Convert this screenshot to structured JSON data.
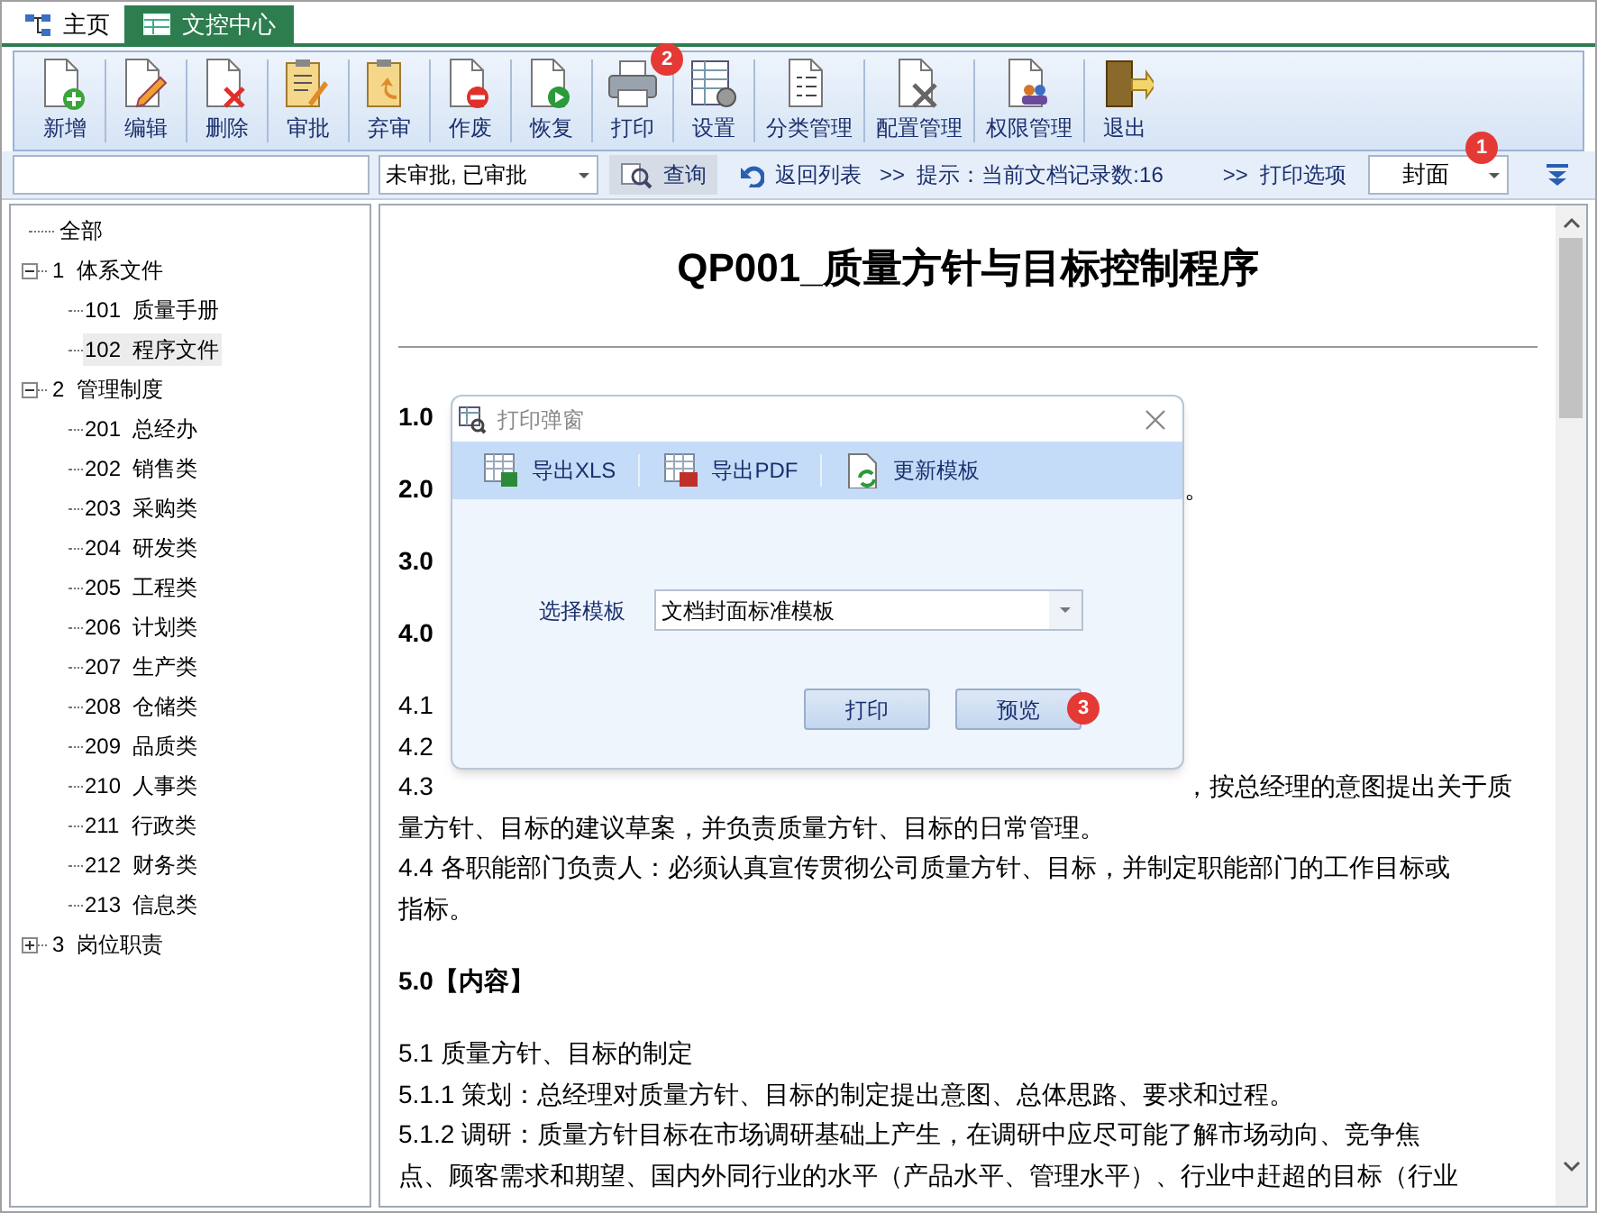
{
  "tabs": [
    {
      "label": "主页",
      "selected": false
    },
    {
      "label": "文控中心",
      "selected": true
    }
  ],
  "toolbar": [
    {
      "label": "新增"
    },
    {
      "label": "编辑"
    },
    {
      "label": "删除"
    },
    {
      "label": "审批"
    },
    {
      "label": "弃审"
    },
    {
      "label": "作废"
    },
    {
      "label": "恢复"
    },
    {
      "label": "打印",
      "badge": "2"
    },
    {
      "label": "设置"
    },
    {
      "label": "分类管理"
    },
    {
      "label": "配置管理"
    },
    {
      "label": "权限管理"
    },
    {
      "label": "退出"
    }
  ],
  "filter_bar": {
    "status_select": "未审批, 已审批",
    "query_button": "查询",
    "back_link": "返回列表",
    "hint": ">>  提示：当前文档记录数:16",
    "print_options": ">>  打印选项",
    "print_select": "封面",
    "print_badge": "1"
  },
  "tree": [
    {
      "label": "全部",
      "selected": false
    },
    {
      "label": "1  体系文件",
      "expanded": true,
      "selected": false,
      "children": [
        {
          "label": "101  质量手册",
          "selected": false
        },
        {
          "label": "102  程序文件",
          "selected": true
        }
      ]
    },
    {
      "label": "2  管理制度",
      "expanded": true,
      "selected": false,
      "children": [
        {
          "label": "201  总经办",
          "selected": false
        },
        {
          "label": "202  销售类",
          "selected": false
        },
        {
          "label": "203  采购类",
          "selected": false
        },
        {
          "label": "204  研发类",
          "selected": false
        },
        {
          "label": "205  工程类",
          "selected": false
        },
        {
          "label": "206  计划类",
          "selected": false
        },
        {
          "label": "207  生产类",
          "selected": false
        },
        {
          "label": "208  仓储类",
          "selected": false
        },
        {
          "label": "209  品质类",
          "selected": false
        },
        {
          "label": "210  人事类",
          "selected": false
        },
        {
          "label": "211  行政类",
          "selected": false
        },
        {
          "label": "212  财务类",
          "selected": false
        },
        {
          "label": "213  信息类",
          "selected": false
        }
      ]
    },
    {
      "label": "3  岗位职责",
      "expanded": false,
      "selected": false
    }
  ],
  "document": {
    "title": "QP001_质量方针与目标控制程序",
    "lines": [
      {
        "kind": "heading",
        "text": "1.0"
      },
      {
        "kind": "heading",
        "text": "2.0",
        "tail": "。"
      },
      {
        "kind": "heading",
        "text": "3.0"
      },
      {
        "kind": "heading",
        "text": "4.0"
      },
      {
        "kind": "body",
        "text": "4.1"
      },
      {
        "kind": "body",
        "text": "4.2"
      },
      {
        "kind": "body",
        "text": "4.3",
        "tail": "，按总经理的意图提出关于质"
      },
      {
        "kind": "body",
        "text": "量方针、目标的建议草案，并负责质量方针、目标的日常管理。"
      },
      {
        "kind": "body",
        "text": "4.4 各职能部门负责人：必须认真宣传贯彻公司质量方针、目标，并制定职能部门的工作目标或"
      },
      {
        "kind": "body",
        "text": "指标。"
      },
      {
        "kind": "gap"
      },
      {
        "kind": "heading",
        "text": "5.0【内容】"
      },
      {
        "kind": "body",
        "text": "5.1 质量方针、目标的制定"
      },
      {
        "kind": "body",
        "text": "5.1.1 策划：总经理对质量方针、目标的制定提出意图、总体思路、要求和过程。"
      },
      {
        "kind": "body",
        "text": "5.1.2 调研：质量方针目标在市场调研基础上产生，在调研中应尽可能了解市场动向、竞争焦"
      },
      {
        "kind": "body",
        "text": "点、顾客需求和期望、国内外同行业的水平（产品水平、管理水平）、行业中赶超的目标（行业"
      }
    ]
  },
  "dialog": {
    "title": "打印弹窗",
    "tools": [
      {
        "label": "导出XLS"
      },
      {
        "label": "导出PDF"
      },
      {
        "label": "更新模板"
      }
    ],
    "template_label": "选择模板",
    "template_value": "文档封面标准模板",
    "buttons": [
      {
        "label": "打印"
      },
      {
        "label": "预览",
        "badge": "3"
      }
    ]
  }
}
